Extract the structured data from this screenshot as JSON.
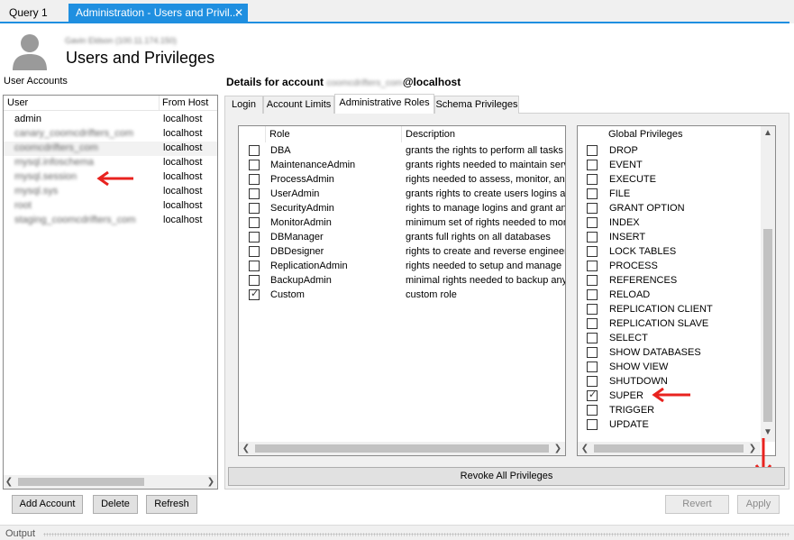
{
  "tabs": [
    {
      "label": "Query 1",
      "active": false
    },
    {
      "label": "Administration - Users and Privil...",
      "active": true
    }
  ],
  "close_glyph": "✕",
  "header": {
    "title": "Users and Privileges",
    "blurred_connection": "Gavin Eldson (100.11.174.150)"
  },
  "user_accounts": {
    "label": "User Accounts",
    "columns": [
      "User",
      "From Host"
    ],
    "rows": [
      {
        "user": "admin",
        "host": "localhost",
        "blurred": false
      },
      {
        "user": "canary_coomcdrifters_com",
        "host": "localhost",
        "blurred": true
      },
      {
        "user": "coomcdrifters_com",
        "host": "localhost",
        "blurred": true
      },
      {
        "user": "mysql.infoschema",
        "host": "localhost",
        "blurred": true
      },
      {
        "user": "mysql.session",
        "host": "localhost",
        "blurred": true
      },
      {
        "user": "mysql.sys",
        "host": "localhost",
        "blurred": true
      },
      {
        "user": "root",
        "host": "localhost",
        "blurred": true
      },
      {
        "user": "staging_coomcdrifters_com",
        "host": "localhost",
        "blurred": true
      }
    ],
    "selected_index": 2
  },
  "buttons": {
    "add_account": "Add Account",
    "delete": "Delete",
    "refresh": "Refresh",
    "revoke_all": "Revoke All Privileges",
    "revert": "Revert",
    "apply": "Apply"
  },
  "details": {
    "prefix": "Details for account",
    "blurred_account": "coomcdrifters_com",
    "suffix": "@localhost",
    "tabs": [
      "Login",
      "Account Limits",
      "Administrative Roles",
      "Schema Privileges"
    ],
    "active_tab": "Administrative Roles"
  },
  "roles": {
    "columns": [
      "Role",
      "Description"
    ],
    "rows": [
      {
        "name": "DBA",
        "desc": "grants the rights to perform all tasks",
        "checked": false
      },
      {
        "name": "MaintenanceAdmin",
        "desc": "grants rights needed to maintain server",
        "checked": false
      },
      {
        "name": "ProcessAdmin",
        "desc": "rights needed to assess, monitor, and kill",
        "checked": false
      },
      {
        "name": "UserAdmin",
        "desc": "grants rights to create users logins and",
        "checked": false
      },
      {
        "name": "SecurityAdmin",
        "desc": "rights to manage logins and grant and",
        "checked": false
      },
      {
        "name": "MonitorAdmin",
        "desc": "minimum set of rights needed to monitor",
        "checked": false
      },
      {
        "name": "DBManager",
        "desc": "grants full rights on all databases",
        "checked": false
      },
      {
        "name": "DBDesigner",
        "desc": "rights to create and reverse engineer",
        "checked": false
      },
      {
        "name": "ReplicationAdmin",
        "desc": "rights needed to setup and manage",
        "checked": false
      },
      {
        "name": "BackupAdmin",
        "desc": "minimal rights needed to backup any",
        "checked": false
      },
      {
        "name": "Custom",
        "desc": "custom role",
        "checked": true
      }
    ]
  },
  "global_privileges": {
    "header": "Global Privileges",
    "rows": [
      {
        "name": "DROP",
        "checked": false
      },
      {
        "name": "EVENT",
        "checked": false
      },
      {
        "name": "EXECUTE",
        "checked": false
      },
      {
        "name": "FILE",
        "checked": false
      },
      {
        "name": "GRANT OPTION",
        "checked": false
      },
      {
        "name": "INDEX",
        "checked": false
      },
      {
        "name": "INSERT",
        "checked": false
      },
      {
        "name": "LOCK TABLES",
        "checked": false
      },
      {
        "name": "PROCESS",
        "checked": false
      },
      {
        "name": "REFERENCES",
        "checked": false
      },
      {
        "name": "RELOAD",
        "checked": false
      },
      {
        "name": "REPLICATION CLIENT",
        "checked": false
      },
      {
        "name": "REPLICATION SLAVE",
        "checked": false
      },
      {
        "name": "SELECT",
        "checked": false
      },
      {
        "name": "SHOW DATABASES",
        "checked": false
      },
      {
        "name": "SHOW VIEW",
        "checked": false
      },
      {
        "name": "SHUTDOWN",
        "checked": false
      },
      {
        "name": "SUPER",
        "checked": true
      },
      {
        "name": "TRIGGER",
        "checked": false
      },
      {
        "name": "UPDATE",
        "checked": false
      }
    ]
  },
  "output": {
    "label": "Output"
  },
  "colors": {
    "accent": "#1f8fe0",
    "annotation": "#e8231f"
  }
}
